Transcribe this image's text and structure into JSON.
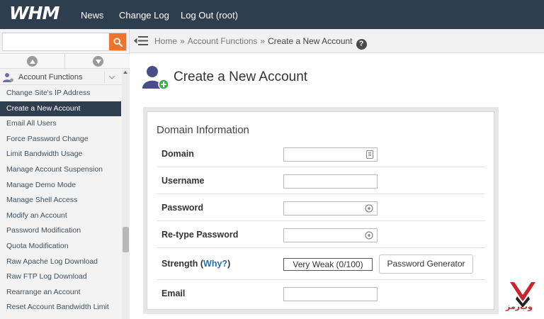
{
  "header": {
    "logo": "WHM",
    "nav": [
      "News",
      "Change Log",
      "Log Out (root)"
    ]
  },
  "sidebar": {
    "search_placeholder": "",
    "group_label": "Account Functions",
    "items": [
      "Change Site's IP Address",
      "Create a New Account",
      "Email All Users",
      "Force Password Change",
      "Limit Bandwidth Usage",
      "Manage Account Suspension",
      "Manage Demo Mode",
      "Manage Shell Access",
      "Modify an Account",
      "Password Modification",
      "Quota Modification",
      "Raw Apache Log Download",
      "Raw FTP Log Download",
      "Rearrange an Account",
      "Reset Account Bandwidth Limit"
    ],
    "active_index": 1
  },
  "breadcrumb": {
    "items": [
      "Home",
      "Account Functions",
      "Create a New Account"
    ],
    "separator": "»"
  },
  "page": {
    "title": "Create a New Account"
  },
  "form": {
    "section_title": "Domain Information",
    "labels": {
      "domain": "Domain",
      "username": "Username",
      "password": "Password",
      "retype": "Re-type Password",
      "strength": "Strength",
      "why": "Why?",
      "email": "Email"
    },
    "values": {
      "domain": "",
      "username": "",
      "password": "",
      "retype": "",
      "email": ""
    },
    "strength_value": "Very Weak (0/100)",
    "generator_button": "Password Generator"
  },
  "watermark": {
    "text": "وب‌رمز"
  },
  "colors": {
    "topbar": "#2e3e4e",
    "search_button": "#f0722b",
    "active_item": "#2e3e4e",
    "link": "#2a6fb0",
    "watermark": "#c9242b"
  }
}
